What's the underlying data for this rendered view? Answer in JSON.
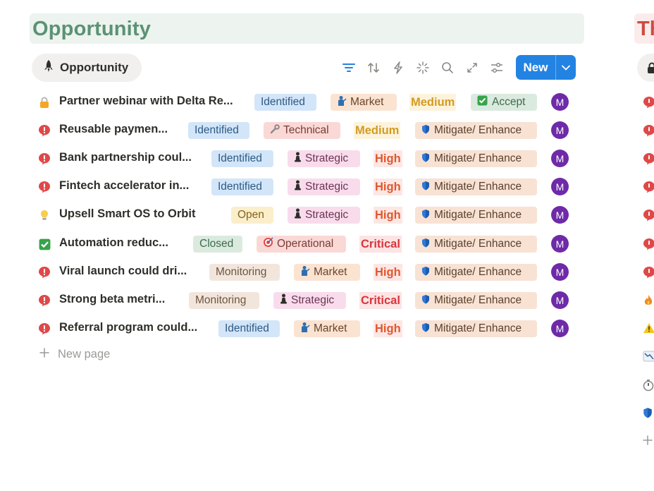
{
  "opportunity_section": {
    "title": "Opportunity",
    "color": "#5b9274"
  },
  "threat_section": {
    "title_visible": "Th",
    "color": "#cc4c42"
  },
  "view_tab": {
    "label": "Opportunity",
    "icon": "rocket-icon"
  },
  "toolbar": {
    "icons": [
      "filter-icon",
      "sort-icon",
      "lightning-icon",
      "sparkle-icon",
      "search-icon",
      "expand-icon",
      "settings-sliders-icon"
    ],
    "new_label": "New",
    "accent": "#2383e2"
  },
  "rows": [
    {
      "icon": "lock-icon",
      "title": "Partner webinar with Delta Re...",
      "status": "Identified",
      "category": "Market",
      "category_icon": "person-pointing-icon",
      "level": "Medium",
      "response": "Accept",
      "response_icon": "check-box-icon",
      "owner_initial": "M"
    },
    {
      "icon": "alert-icon",
      "title": "Reusable paymen...",
      "status": "Identified",
      "category": "Technical",
      "category_icon": "wrench-icon",
      "level": "Medium",
      "response": "Mitigate/ Enhance",
      "response_icon": "shield-icon",
      "owner_initial": "M"
    },
    {
      "icon": "alert-icon",
      "title": "Bank partnership coul...",
      "status": "Identified",
      "category": "Strategic",
      "category_icon": "chess-pawn-icon",
      "level": "High",
      "response": "Mitigate/ Enhance",
      "response_icon": "shield-icon",
      "owner_initial": "M"
    },
    {
      "icon": "alert-icon",
      "title": "Fintech accelerator in...",
      "status": "Identified",
      "category": "Strategic",
      "category_icon": "chess-pawn-icon",
      "level": "High",
      "response": "Mitigate/ Enhance",
      "response_icon": "shield-icon",
      "owner_initial": "M"
    },
    {
      "icon": "lightbulb-icon",
      "title": "Upsell Smart OS to Orbit",
      "status": "Open",
      "category": "Strategic",
      "category_icon": "chess-pawn-icon",
      "level": "High",
      "response": "Mitigate/ Enhance",
      "response_icon": "shield-icon",
      "owner_initial": "M"
    },
    {
      "icon": "check-box-icon",
      "title": "Automation reduc...",
      "status": "Closed",
      "category": "Operational",
      "category_icon": "target-icon",
      "level": "Critical",
      "response": "Mitigate/ Enhance",
      "response_icon": "shield-icon",
      "owner_initial": "M"
    },
    {
      "icon": "alert-icon",
      "title": "Viral launch could dri...",
      "status": "Monitoring",
      "category": "Market",
      "category_icon": "person-pointing-icon",
      "level": "High",
      "response": "Mitigate/ Enhance",
      "response_icon": "shield-icon",
      "owner_initial": "M"
    },
    {
      "icon": "alert-icon",
      "title": "Strong beta metri...",
      "status": "Monitoring",
      "category": "Strategic",
      "category_icon": "chess-pawn-icon",
      "level": "Critical",
      "response": "Mitigate/ Enhance",
      "response_icon": "shield-icon",
      "owner_initial": "M"
    },
    {
      "icon": "alert-icon",
      "title": "Referral program could...",
      "status": "Identified",
      "category": "Market",
      "category_icon": "person-pointing-icon",
      "level": "High",
      "response": "Mitigate/ Enhance",
      "response_icon": "shield-icon",
      "owner_initial": "M"
    }
  ],
  "new_page_label": "New page",
  "side_icons": [
    "alert-icon",
    "alert-icon",
    "alert-icon",
    "alert-icon",
    "alert-icon",
    "alert-icon",
    "alert-icon",
    "fire-icon",
    "warning-icon",
    "chart-down-icon",
    "stopwatch-icon",
    "shield-icon",
    "plus-icon"
  ]
}
